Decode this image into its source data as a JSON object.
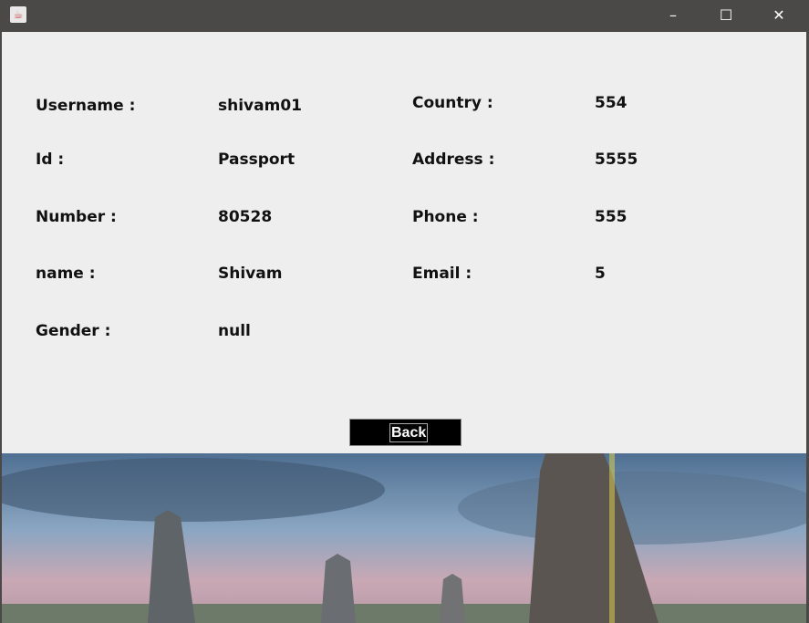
{
  "window": {
    "title": ""
  },
  "fields": [
    {
      "label": "Username :",
      "value": "shivam01"
    },
    {
      "label": "Id :",
      "value": "Passport"
    },
    {
      "label": "Number :",
      "value": "80528"
    },
    {
      "label": "name :",
      "value": "Shivam"
    },
    {
      "label": "Gender :",
      "value": "null"
    }
  ],
  "fields_right": [
    {
      "label": "Country :",
      "value": "554"
    },
    {
      "label": "Address :",
      "value": "5555"
    },
    {
      "label": "Phone :",
      "value": "555"
    },
    {
      "label": "Email :",
      "value": "5"
    }
  ],
  "back_label": "Back"
}
